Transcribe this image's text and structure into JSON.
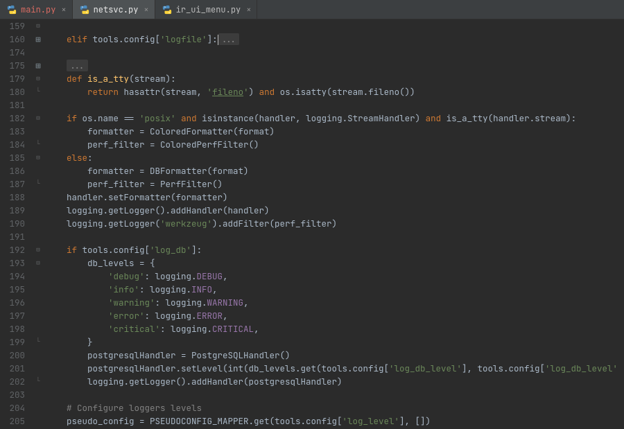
{
  "tabs": [
    {
      "label": "main.py",
      "active": false,
      "red": true
    },
    {
      "label": "netsvc.py",
      "active": true,
      "red": false
    },
    {
      "label": "ir_ui_menu.py",
      "active": false,
      "red": false
    }
  ],
  "folded_ellipsis": "...",
  "lines": [
    {
      "n": "159",
      "f": "−",
      "html": ""
    },
    {
      "n": "160",
      "f": "⊞",
      "html": "    <span class='kw'>elif</span> tools.config[<span class='str'>'logfile'</span>]:<span class='caret'></span><span class='folded'>...</span>"
    },
    {
      "n": "174",
      "f": "",
      "html": ""
    },
    {
      "n": "175",
      "f": "⊞",
      "html": "    <span class='folded'>...</span>"
    },
    {
      "n": "179",
      "f": "−",
      "html": "    <span class='kw'>def</span> <span class='fn'>is_a_tty</span>(stream):"
    },
    {
      "n": "180",
      "f": "⌐",
      "html": "        <span class='kw'>return</span> hasattr(stream, <span class='str'>'<span class='und'>fileno</span>'</span>) <span class='kw'>and</span> os.isatty(stream.fileno())"
    },
    {
      "n": "181",
      "f": "",
      "html": ""
    },
    {
      "n": "182",
      "f": "−",
      "html": "    <span class='kw'>if</span> os.name == <span class='str'>'posix'</span> <span class='kw'>and</span> isinstance(handler, logging.StreamHandler) <span class='kw'>and</span> is_a_tty(handler.stream):"
    },
    {
      "n": "183",
      "f": "",
      "html": "        formatter = ColoredFormatter(format)"
    },
    {
      "n": "184",
      "f": "⌐",
      "html": "        perf_filter = ColoredPerfFilter()"
    },
    {
      "n": "185",
      "f": "−",
      "html": "    <span class='kw'>else</span>:"
    },
    {
      "n": "186",
      "f": "",
      "html": "        formatter = DBFormatter(format)"
    },
    {
      "n": "187",
      "f": "⌐",
      "html": "        perf_filter = PerfFilter()"
    },
    {
      "n": "188",
      "f": "",
      "html": "    handler.setFormatter(formatter)"
    },
    {
      "n": "189",
      "f": "",
      "html": "    logging.getLogger().addHandler(handler)"
    },
    {
      "n": "190",
      "f": "",
      "html": "    logging.getLogger(<span class='str'>'werkzeug'</span>).addFilter(perf_filter)"
    },
    {
      "n": "191",
      "f": "",
      "html": ""
    },
    {
      "n": "192",
      "f": "−",
      "html": "    <span class='kw'>if</span> tools.config[<span class='str'>'log_db'</span>]:"
    },
    {
      "n": "193",
      "f": "−",
      "html": "        db_levels = {"
    },
    {
      "n": "194",
      "f": "",
      "html": "            <span class='str'>'debug'</span>: logging.<span class='prop'>DEBUG</span>,"
    },
    {
      "n": "195",
      "f": "",
      "html": "            <span class='str'>'info'</span>: logging.<span class='prop'>INFO</span>,"
    },
    {
      "n": "196",
      "f": "",
      "html": "            <span class='str'>'warning'</span>: logging.<span class='prop'>WARNING</span>,"
    },
    {
      "n": "197",
      "f": "",
      "html": "            <span class='str'>'error'</span>: logging.<span class='prop'>ERROR</span>,"
    },
    {
      "n": "198",
      "f": "",
      "html": "            <span class='str'>'critical'</span>: logging.<span class='prop'>CRITICAL</span>,"
    },
    {
      "n": "199",
      "f": "⌐",
      "html": "        }"
    },
    {
      "n": "200",
      "f": "",
      "html": "        postgresqlHandler = PostgreSQLHandler()"
    },
    {
      "n": "201",
      "f": "",
      "html": "        postgresqlHandler.setLevel(int(db_levels.get(tools.config[<span class='str'>'log_db_level'</span>], tools.config[<span class='str'>'log_db_level'</span>])))"
    },
    {
      "n": "202",
      "f": "⌐",
      "html": "        logging.getLogger().addHandler(postgresqlHandler)"
    },
    {
      "n": "203",
      "f": "",
      "html": ""
    },
    {
      "n": "204",
      "f": "",
      "html": "    <span class='cmt'># Configure loggers levels</span>"
    },
    {
      "n": "205",
      "f": "",
      "html": "    pseudo_config = PSEUDOCONFIG_MAPPER.get(tools.config[<span class='str'>'log_level'</span>], [])"
    }
  ]
}
